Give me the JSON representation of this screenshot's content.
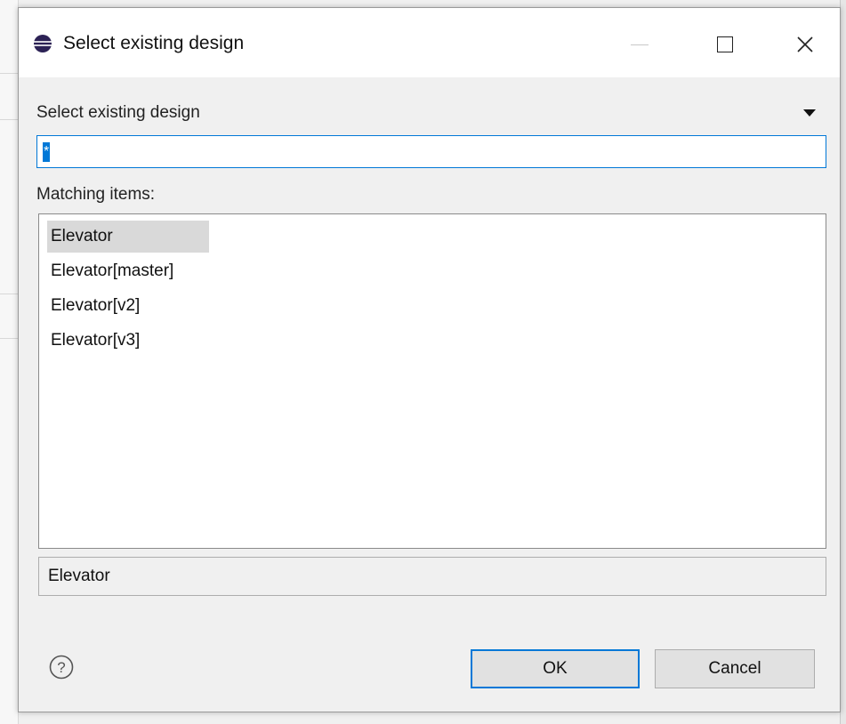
{
  "dialog": {
    "title": "Select existing design",
    "section_label": "Select existing design",
    "filter": {
      "value": "*"
    },
    "matching_label": "Matching items:",
    "items": [
      {
        "label": "Elevator",
        "selected": true
      },
      {
        "label": "Elevator[master]",
        "selected": false
      },
      {
        "label": "Elevator[v2]",
        "selected": false
      },
      {
        "label": "Elevator[v3]",
        "selected": false
      }
    ],
    "status_text": "Elevator",
    "buttons": {
      "ok": "OK",
      "cancel": "Cancel"
    }
  },
  "icons": {
    "app": "eclipse-icon",
    "help": "help-icon",
    "menu": "dropdown-arrow-icon"
  },
  "colors": {
    "accent": "#0078d7",
    "selection": "#d9d9d9"
  }
}
